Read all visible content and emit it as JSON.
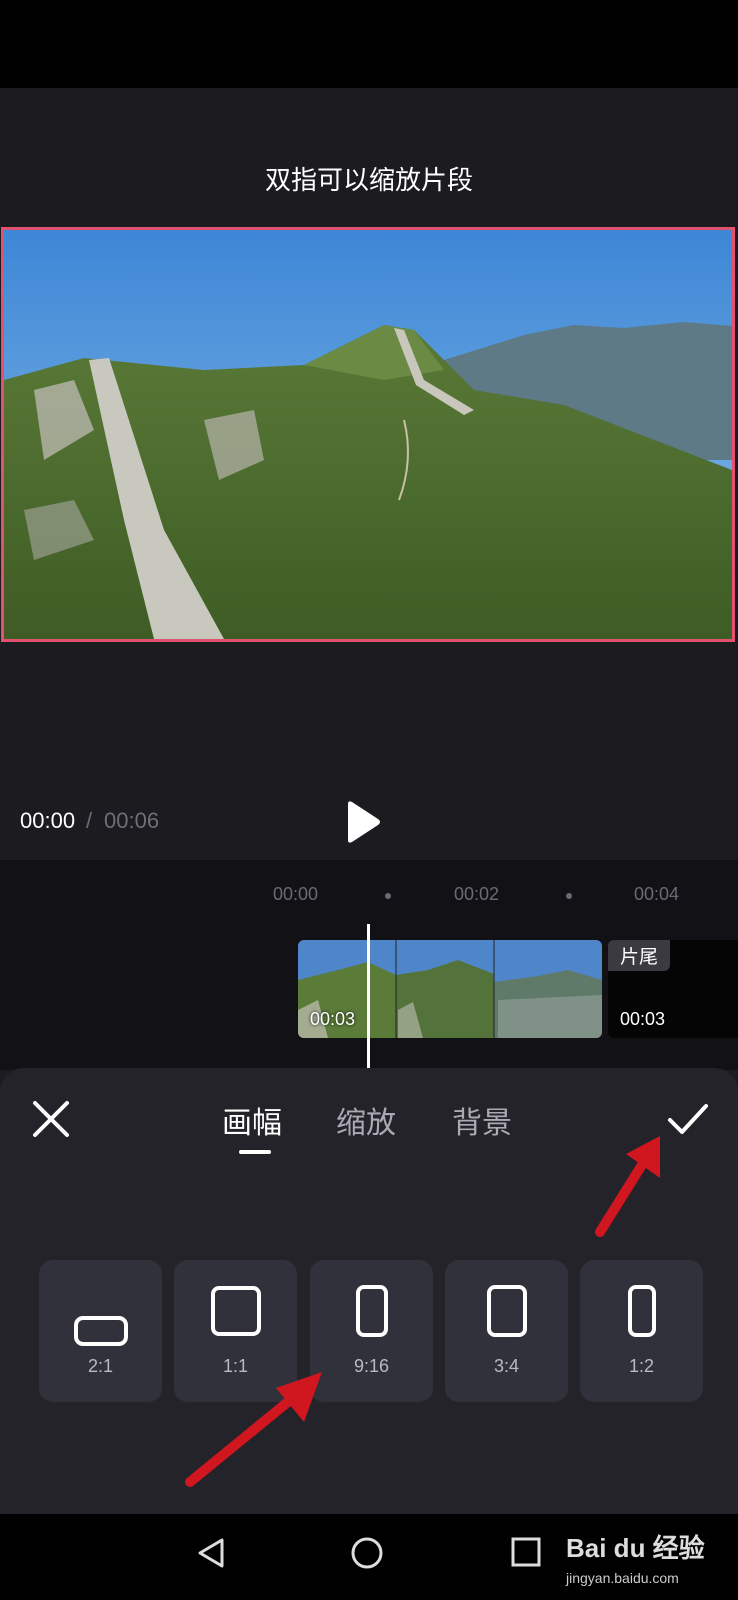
{
  "hint_text": "双指可以缩放片段",
  "player": {
    "current_time": "00:00",
    "separator": "/",
    "total_time": "00:06"
  },
  "timeline": {
    "ruler": [
      "00:00",
      "00:02",
      "00:04"
    ],
    "clip_main_duration": "00:03",
    "end_clip_label": "片尾",
    "end_clip_duration": "00:03"
  },
  "sheet": {
    "tabs": [
      {
        "label": "画幅",
        "active": true
      },
      {
        "label": "缩放",
        "active": false
      },
      {
        "label": "背景",
        "active": false
      }
    ],
    "ratios": [
      {
        "label": "2:1"
      },
      {
        "label": "1:1"
      },
      {
        "label": "9:16"
      },
      {
        "label": "3:4"
      },
      {
        "label": "1:2"
      }
    ]
  },
  "watermark": {
    "brand": "Bai du 经验",
    "url": "jingyan.baidu.com"
  },
  "icons": {
    "close": "close-icon",
    "confirm": "check-icon",
    "play": "play-icon",
    "nav_back": "triangle-back-icon",
    "nav_home": "circle-home-icon",
    "nav_recents": "square-recents-icon"
  },
  "colors": {
    "accent_border": "#e0526f",
    "annotation_arrow": "#d0161e"
  }
}
